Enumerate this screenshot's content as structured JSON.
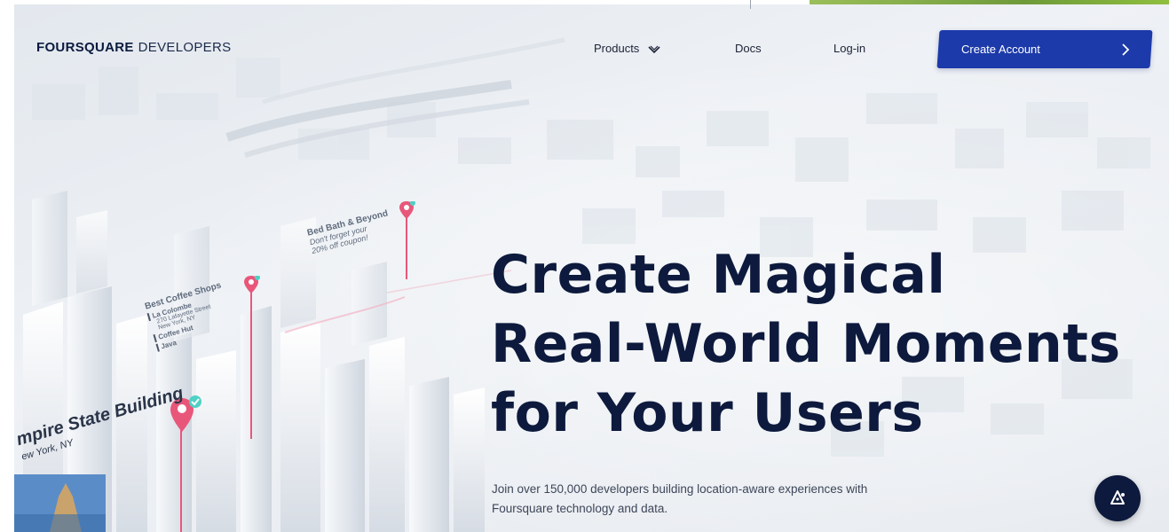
{
  "header": {
    "logo_brand": "FOURSQUARE",
    "logo_sub": "DEVELOPERS",
    "nav": {
      "products": "Products",
      "docs": "Docs",
      "login": "Log-in"
    },
    "create_account": "Create Account"
  },
  "hero": {
    "headline_lines": [
      "Create Magical",
      "Real-World Moments",
      "for Your Users"
    ],
    "subtext_lines": [
      "Join over 150,000 developers building location-aware experiences with",
      "Foursquare technology and data."
    ]
  },
  "map_overlays": {
    "bed_bath": {
      "title": "Bed Bath & Beyond",
      "line1": "Don't forget your",
      "line2": "20% off coupon!"
    },
    "coffee": {
      "title": "Best Coffee Shops",
      "item1": "La Colombe",
      "item1_addr1": "270 Lafayette Street",
      "item1_addr2": "New York, NY",
      "item2": "Coffee Hut",
      "item3": "Java"
    },
    "empire": {
      "name": "mpire State Building",
      "city": "ew York, NY"
    }
  },
  "icons": {
    "products_chevron": "chevron-down-icon",
    "create_arrow": "chevron-right-icon",
    "chat": "chat-icon",
    "pins": "map-pin-icon"
  },
  "colors": {
    "accent": "#1c3aa9",
    "headline": "#0d1a3d",
    "pin": "#e8577a",
    "check": "#4fd1c5"
  }
}
